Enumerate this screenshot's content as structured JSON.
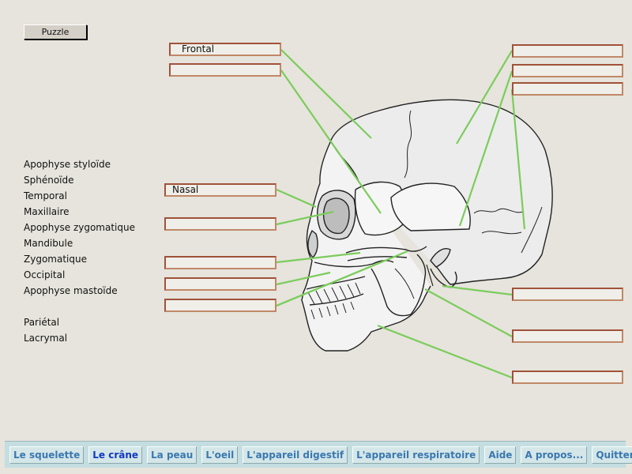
{
  "puzzle_button": "Puzzle",
  "terms": [
    "Apophyse styloïde",
    "Sphénoïde",
    "Temporal",
    "Maxillaire",
    "Apophyse zygomatique",
    "Mandibule",
    "Zygomatique",
    "Occipital",
    "Apophyse mastoïde",
    "",
    "Pariétal",
    "Lacrymal"
  ],
  "slots": {
    "left_1": "Frontal",
    "left_2": "",
    "left_3": "Nasal",
    "left_4": "",
    "left_5": "",
    "left_6": "",
    "left_7": "",
    "right_1": "",
    "right_2": "",
    "right_3": "",
    "right_4": "",
    "right_5": "",
    "right_6": ""
  },
  "nav": [
    "Le squelette",
    "Le crâne",
    "La peau",
    "L'oeil",
    "L'appareil digestif",
    "L'appareil respiratoire",
    "Aide",
    "A propos...",
    "Quitter"
  ],
  "colors": {
    "leader_line": "#7ccc5c",
    "slot_border": "#a0523a",
    "nav_text": "#3a78b0"
  }
}
